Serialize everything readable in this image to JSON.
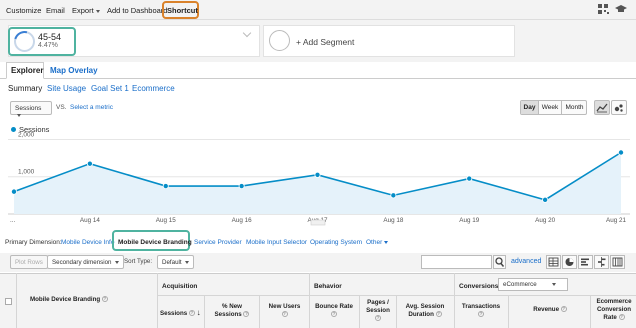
{
  "toolbar": {
    "items": [
      {
        "label": "Customize"
      },
      {
        "label": "Email"
      },
      {
        "label": "Export"
      },
      {
        "label": "Add to Dashboard"
      },
      {
        "label": "Shortcut"
      }
    ],
    "icons": [
      "qr-grid-icon",
      "graduation-cap-icon"
    ]
  },
  "segments": {
    "active": {
      "name": "45-54",
      "percent": "4.47%"
    },
    "add_label": "+ Add Segment"
  },
  "tabs": [
    "Explorer",
    "Map Overlay"
  ],
  "subtabs": [
    "Summary",
    "Site Usage",
    "Goal Set 1",
    "Ecommerce"
  ],
  "metric": {
    "selected": "Sessions",
    "vs": "VS.",
    "select_metric": "Select a metric"
  },
  "period": {
    "buttons": [
      "Day",
      "Week",
      "Month"
    ],
    "active": "Day"
  },
  "chart_data": {
    "type": "line",
    "series": [
      {
        "name": "Sessions",
        "values": [
          600,
          1350,
          750,
          750,
          1050,
          500,
          950,
          380,
          1650
        ]
      }
    ],
    "x": [
      "...",
      "Aug 14",
      "Aug 15",
      "Aug 16",
      "Aug 17",
      "Aug 18",
      "Aug 19",
      "Aug 20",
      "Aug 21"
    ],
    "y_ticks": [
      "2,000",
      "1,000"
    ],
    "ylim": [
      0,
      2200
    ],
    "grid": true,
    "color": "#058dc7",
    "fill": "#e5f2fa"
  },
  "primary_dimension": {
    "label": "Primary Dimension:",
    "options": [
      "Mobile Device Info",
      "Mobile Device Branding",
      "Service Provider",
      "Mobile Input Selector",
      "Operating System",
      "Other"
    ],
    "active": "Mobile Device Branding"
  },
  "table_controls": {
    "plot_rows": "Plot Rows",
    "secondary_dimension": "Secondary dimension",
    "sort_type_label": "Sort Type:",
    "sort_type_value": "Default",
    "search_placeholder": "",
    "advanced": "advanced"
  },
  "table_header": {
    "dimension": "Mobile Device Branding",
    "groups": [
      "Acquisition",
      "Behavior",
      "Conversions"
    ],
    "conversion_select": "eCommerce",
    "columns": {
      "sessions": "Sessions",
      "new_sessions_1": "% New",
      "new_sessions_2": "Sessions",
      "new_users": "New Users",
      "bounce_rate": "Bounce Rate",
      "pages_session_1": "Pages /",
      "pages_session_2": "Session",
      "avg_duration_1": "Avg. Session",
      "avg_duration_2": "Duration",
      "transactions": "Transactions",
      "revenue": "Revenue",
      "ecr_1": "Ecommerce",
      "ecr_2": "Conversion",
      "ecr_3": "Rate"
    }
  },
  "colors": {
    "accent": "#1a6ec9",
    "highlight_teal": "#4fb3a0",
    "highlight_orange": "#d9822b",
    "line": "#058dc7"
  }
}
